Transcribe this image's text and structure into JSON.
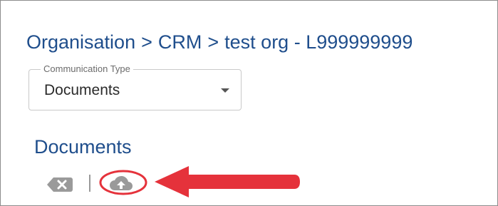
{
  "breadcrumb": {
    "organisation": "Organisation",
    "separator_1": ">",
    "crm": "CRM",
    "separator_2": ">",
    "record": "test org - L999999999"
  },
  "communication_type": {
    "legend": "Communication Type",
    "value": "Documents"
  },
  "documents_section": {
    "title": "Documents"
  },
  "toolbar": {
    "clear_icon": "backspace-icon",
    "upload_icon": "cloud-upload-icon"
  },
  "annotation": {
    "color": "#e5323b"
  },
  "colors": {
    "heading": "#1f4e8c",
    "icon": "#9a9a9a"
  }
}
